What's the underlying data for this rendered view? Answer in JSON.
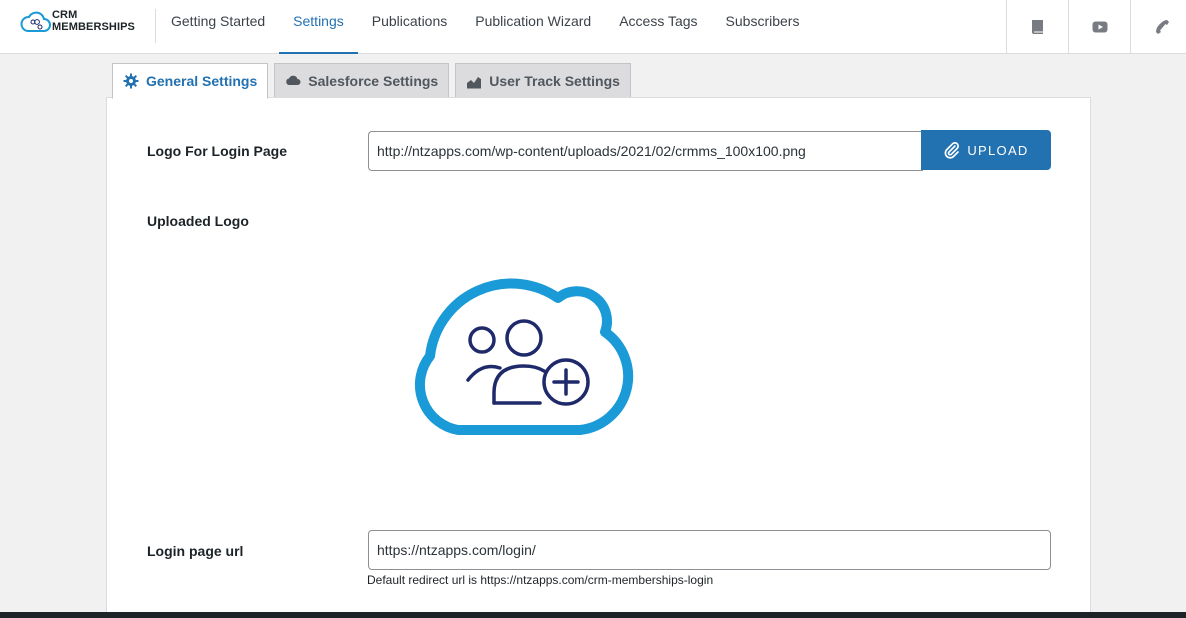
{
  "brand": {
    "line1": "CRM",
    "line2": "MEMBERSHIPS"
  },
  "nav": [
    {
      "label": "Getting Started",
      "active": false
    },
    {
      "label": "Settings",
      "active": true
    },
    {
      "label": "Publications",
      "active": false
    },
    {
      "label": "Publication Wizard",
      "active": false
    },
    {
      "label": "Access Tags",
      "active": false
    },
    {
      "label": "Subscribers",
      "active": false
    }
  ],
  "toolbar_icons": [
    "book-icon",
    "youtube-icon",
    "phone-icon"
  ],
  "tabs": [
    {
      "label": "General Settings",
      "icon": "gear-icon",
      "active": true
    },
    {
      "label": "Salesforce Settings",
      "icon": "cloud-icon",
      "active": false
    },
    {
      "label": "User Track Settings",
      "icon": "chart-icon",
      "active": false
    }
  ],
  "settings": {
    "logo_label": "Logo For Login Page",
    "logo_url": "http://ntzapps.com/wp-content/uploads/2021/02/crmms_100x100.png",
    "upload_label": "UPLOAD",
    "uploaded_logo_label": "Uploaded Logo",
    "login_url_label": "Login page url",
    "login_url": "https://ntzapps.com/login/",
    "hint": "Default redirect url is https://ntzapps.com/crm-memberships-login"
  },
  "colors": {
    "accent": "#2271b1",
    "logo_blue": "#1a9ad6",
    "logo_navy": "#1f2a6b"
  }
}
